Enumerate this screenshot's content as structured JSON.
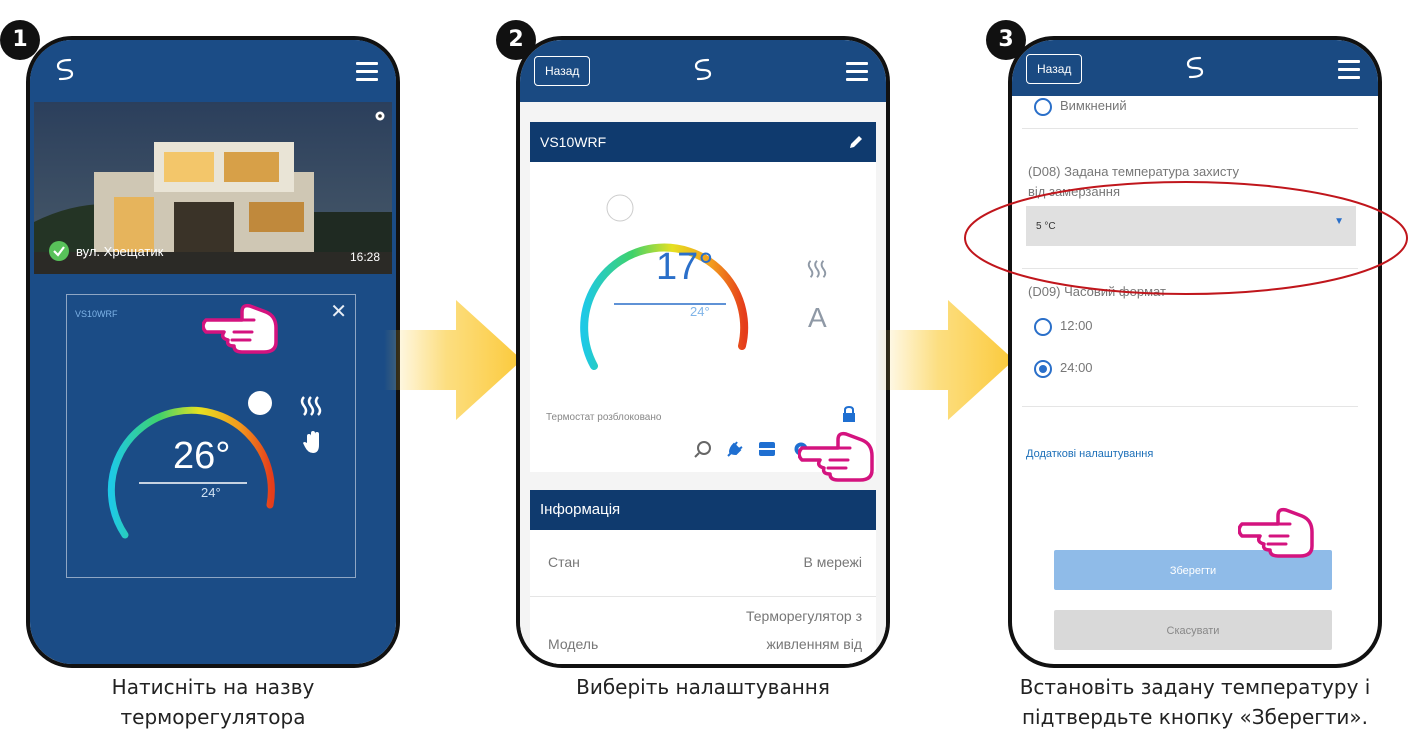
{
  "steps": [
    {
      "number": "1",
      "caption_line1": "Натисніть на назву",
      "caption_line2": "терморегулятора"
    },
    {
      "number": "2",
      "caption_line1": "Виберіть налаштування",
      "caption_line2": ""
    },
    {
      "number": "3",
      "caption_line1": "Встановіть задану температуру і",
      "caption_line2": "підтвердьте кнопку «Зберегти»."
    }
  ],
  "screen1": {
    "address": "вул. Хрещатик",
    "time": "16:28",
    "device_name": "VS10WRF",
    "current_temp": "26°",
    "set_temp": "24°",
    "dial_level": 0.8
  },
  "screen2": {
    "back_label": "Назад",
    "device_name": "VS10WRF",
    "current_temp": "17°",
    "set_temp": "24°",
    "status_text": "Термостат розблоковано",
    "mode_letter": "A",
    "info_title": "Інформація",
    "state_label": "Стан",
    "state_value": "В мережі",
    "model_label": "Модель",
    "model_value_line1": "Терморегулятор з",
    "model_value_line2": "живленням від",
    "dial_level": 0.05
  },
  "screen3": {
    "back_label": "Назад",
    "option_off": "Вимкнений",
    "d08_label_line1": "(D08) Задана температура захисту",
    "d08_label_line2": "від замерзання",
    "d08_value": "5 °C",
    "d09_label": "(D09) Часовий формат",
    "option_12": "12:00",
    "option_24": "24:00",
    "selected_format": "24:00",
    "more_settings": "Додаткові налаштування",
    "save_label": "Зберегти",
    "cancel_label": "Скасувати"
  },
  "colors": {
    "brand_blue": "#1a4a82",
    "panel_blue": "#174a86",
    "header_navy": "#0f3a6e",
    "highlight_red": "#c0161c",
    "hand_magenta": "#d4137f",
    "arrow_yellow": "#fbd04a",
    "save_button": "#8fbbe8",
    "cancel_button": "#d9d9d9"
  },
  "icons": [
    "logo-icon",
    "menu-icon",
    "gear-icon",
    "check-icon",
    "close-icon",
    "heat-icon",
    "hand-manual-icon",
    "pencil-icon",
    "lock-icon",
    "zoom-icon",
    "plug-icon",
    "card-icon",
    "dropdown-arrow-icon",
    "pointing-hand-icon",
    "right-arrow-icon"
  ]
}
